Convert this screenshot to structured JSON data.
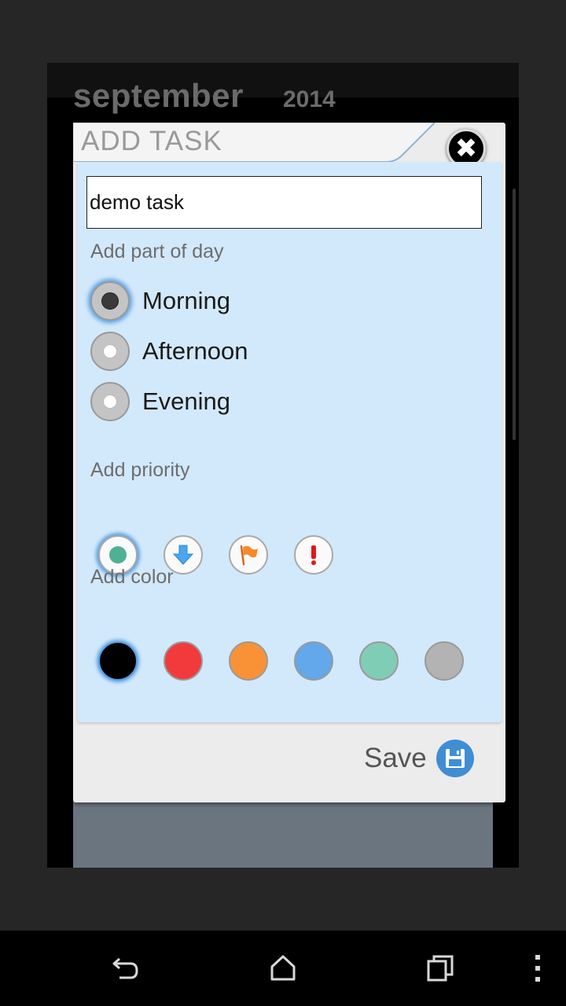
{
  "background": {
    "month": "september",
    "year": "2014"
  },
  "dialog": {
    "title": "ADD TASK",
    "task_input_value": "demo task",
    "part_of_day": {
      "label": "Add part of day",
      "options": [
        "Morning",
        "Afternoon",
        "Evening"
      ],
      "selected": "Morning"
    },
    "priority": {
      "label": "Add priority",
      "options": [
        "normal-icon",
        "low-arrow-icon",
        "flag-icon",
        "exclamation-icon"
      ],
      "selected": "normal-icon"
    },
    "color": {
      "label": "Add color",
      "swatches": [
        "#000000",
        "#f23a3c",
        "#f99237",
        "#62a8ea",
        "#7fcdb5",
        "#b3b3b3"
      ],
      "selected": "#000000"
    },
    "save_label": "Save"
  },
  "colors": {
    "panel": "#d2e9fb",
    "accent": "#3f8ed4"
  }
}
